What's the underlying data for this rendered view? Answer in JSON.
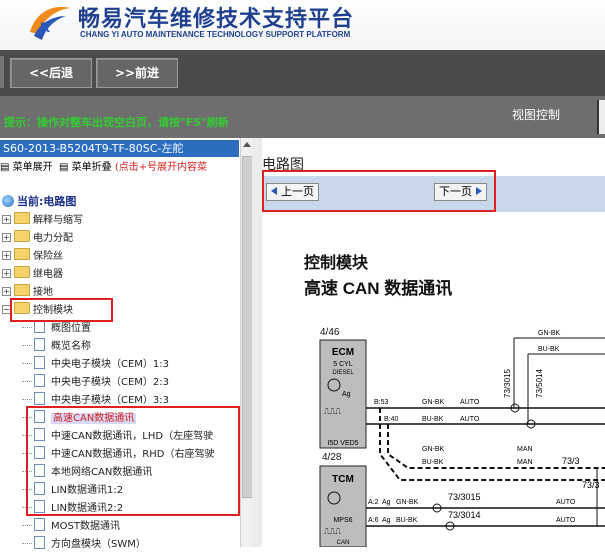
{
  "header": {
    "title": "畅易汽车维修技术支持平台",
    "subtitle": "CHANG YI AUTO MAINTENANCE TECHNOLOGY SUPPORT PLATFORM"
  },
  "toolbar": {
    "back_label": "<<后退",
    "forward_label": ">>前进"
  },
  "status": {
    "tip": "提示：操作对整车出现空白页，请按\"F5\"刷新",
    "view_control": "视图控制"
  },
  "sidebar": {
    "vehicle": "S60-2013-B5204T9-TF-80SC-左舵",
    "menu_expand": "菜单展开",
    "menu_collapse": "菜单折叠",
    "menu_hint": "(点击+号展开内容菜",
    "current_label": "当前:电路图",
    "folders": [
      {
        "label": "解释与缩写"
      },
      {
        "label": "电力分配"
      },
      {
        "label": "保险丝"
      },
      {
        "label": "继电器"
      },
      {
        "label": "接地"
      },
      {
        "label": "控制模块"
      }
    ],
    "docs": [
      {
        "label": "概图位置"
      },
      {
        "label": "概览名称"
      },
      {
        "label": "中央电子模块（CEM）1:3"
      },
      {
        "label": "中央电子模块（CEM）2:3"
      },
      {
        "label": "中央电子模块（CEM）3:3"
      },
      {
        "label": "高速CAN数据通讯"
      },
      {
        "label": "中速CAN数据通讯，LHD（左座驾驶"
      },
      {
        "label": "中速CAN数据通讯，RHD（右座驾驶"
      },
      {
        "label": "本地网络CAN数据通讯"
      },
      {
        "label": "LIN数据通讯1:2"
      },
      {
        "label": "LIN数据通讯2:2"
      },
      {
        "label": "MOST数据通讯"
      },
      {
        "label": "方向盘模块（SWM）"
      }
    ]
  },
  "main": {
    "title": "电路图",
    "prev_label": "上一页",
    "next_label": "下一页"
  },
  "diagram": {
    "heading1": "控制模块",
    "heading2": "高速 CAN 数据通讯",
    "ref1": "4/46",
    "ref2": "4/28",
    "ecm": {
      "title": "ECM",
      "line1": "5 CYL",
      "line2": "DIESEL",
      "line3": "I5D VED5"
    },
    "tcm": {
      "title": "TCM",
      "line1": "MPS6",
      "line2": "CAN"
    },
    "pins": [
      "B:53",
      "B:40",
      "A:2",
      "A:6"
    ],
    "ag": "Ag",
    "wires": [
      "GN-BK",
      "BU-BK",
      "GN-BK",
      "BU-BK",
      "AUTO",
      "AUTO",
      "MAN",
      "MAN",
      "GN-BK",
      "BU-BK",
      "GN-BK",
      "BU-BK",
      "AUTO",
      "AUTO"
    ],
    "conns": [
      "73/3015",
      "73/5014",
      "73/3015",
      "73/3014",
      "73/3",
      "73/3"
    ]
  }
}
